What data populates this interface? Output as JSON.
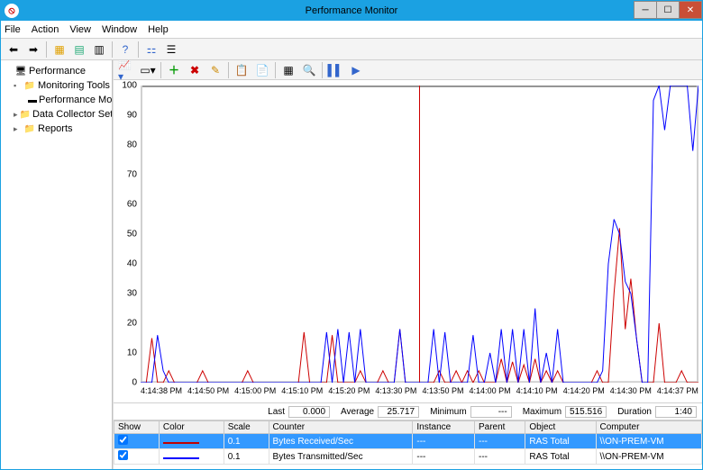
{
  "window": {
    "title": "Performance Monitor"
  },
  "menu": [
    "File",
    "Action",
    "View",
    "Window",
    "Help"
  ],
  "tree": {
    "root": "Performance",
    "monitoring": "Monitoring Tools",
    "perfmon": "Performance Monitor",
    "dcs": "Data Collector Sets",
    "reports": "Reports"
  },
  "stats": {
    "labels": {
      "last": "Last",
      "average": "Average",
      "minimum": "Minimum",
      "maximum": "Maximum",
      "duration": "Duration"
    },
    "values": {
      "last": "0.000",
      "average": "25.717",
      "minimum": "---",
      "maximum": "515.516",
      "duration": "1:40"
    }
  },
  "legend": {
    "columns": [
      "Show",
      "Color",
      "Scale",
      "Counter",
      "Instance",
      "Parent",
      "Object",
      "Computer"
    ],
    "rows": [
      {
        "show": true,
        "color": "#c00000",
        "scale": "0.1",
        "counter": "Bytes Received/Sec",
        "instance": "---",
        "parent": "---",
        "object": "RAS Total",
        "computer": "\\\\ON-PREM-VM",
        "selected": true
      },
      {
        "show": true,
        "color": "#0000ff",
        "scale": "0.1",
        "counter": "Bytes Transmitted/Sec",
        "instance": "---",
        "parent": "---",
        "object": "RAS Total",
        "computer": "\\\\ON-PREM-VM",
        "selected": false
      }
    ]
  },
  "chart_data": {
    "type": "line",
    "ylim": [
      0,
      100
    ],
    "yticks": [
      0,
      10,
      20,
      30,
      40,
      50,
      60,
      70,
      80,
      90,
      100
    ],
    "xticks": [
      "4:14:38 PM",
      "4:14:50 PM",
      "4:15:00 PM",
      "4:15:10 PM",
      "4:15:20 PM",
      "4:13:30 PM",
      "4:13:50 PM",
      "4:14:00 PM",
      "4:14:10 PM",
      "4:14:20 PM",
      "4:14:30 PM",
      "4:14:37 PM"
    ],
    "cursor_x": 50,
    "series": [
      {
        "name": "Bytes Received/Sec",
        "color": "#c00000",
        "values": [
          0,
          0,
          15,
          0,
          0,
          4,
          0,
          0,
          0,
          0,
          0,
          4,
          0,
          0,
          0,
          0,
          0,
          0,
          0,
          4,
          0,
          0,
          0,
          0,
          0,
          0,
          0,
          0,
          0,
          17,
          0,
          0,
          0,
          0,
          16,
          0,
          0,
          0,
          0,
          4,
          0,
          0,
          0,
          4,
          0,
          0,
          18,
          0,
          0,
          0,
          0,
          0,
          0,
          4,
          0,
          0,
          4,
          0,
          4,
          0,
          4,
          0,
          0,
          0,
          8,
          0,
          7,
          0,
          6,
          0,
          8,
          0,
          4,
          0,
          4,
          0,
          0,
          0,
          0,
          0,
          0,
          4,
          0,
          0,
          30,
          52,
          18,
          35,
          15,
          0,
          0,
          0,
          20,
          0,
          0,
          0,
          4,
          0,
          0,
          0
        ]
      },
      {
        "name": "Bytes Transmitted/Sec",
        "color": "#0000ff",
        "values": [
          0,
          0,
          0,
          16,
          4,
          0,
          0,
          0,
          0,
          0,
          0,
          0,
          0,
          0,
          0,
          0,
          0,
          0,
          0,
          0,
          0,
          0,
          0,
          0,
          0,
          0,
          0,
          0,
          0,
          0,
          0,
          0,
          0,
          17,
          0,
          18,
          0,
          17,
          0,
          18,
          0,
          0,
          0,
          0,
          0,
          0,
          18,
          0,
          0,
          0,
          0,
          0,
          18,
          0,
          17,
          0,
          0,
          0,
          0,
          16,
          0,
          0,
          10,
          0,
          18,
          0,
          18,
          0,
          18,
          0,
          25,
          0,
          10,
          0,
          18,
          0,
          0,
          0,
          0,
          0,
          0,
          0,
          4,
          40,
          55,
          50,
          34,
          30,
          15,
          0,
          0,
          95,
          100,
          85,
          100,
          100,
          100,
          100,
          78,
          100
        ]
      }
    ]
  }
}
